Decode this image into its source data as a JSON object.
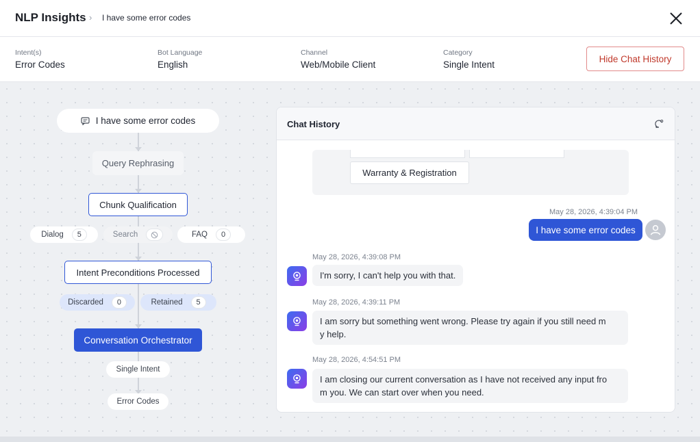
{
  "header": {
    "app_title": "NLP Insights",
    "breadcrumb_sep": "›",
    "breadcrumb": "I have some error codes"
  },
  "meta": {
    "intents_label": "Intent(s)",
    "intents_value": "Error Codes",
    "language_label": "Bot Language",
    "language_value": "English",
    "channel_label": "Channel",
    "channel_value": "Web/Mobile Client",
    "category_label": "Category",
    "category_value": "Single Intent",
    "hide_button": "Hide Chat History"
  },
  "flow": {
    "query": "I have some error codes",
    "rephrasing": "Query Rephrasing",
    "chunk_qualification": "Chunk Qualification",
    "pills_chunk": [
      {
        "label": "Dialog",
        "count": "5"
      },
      {
        "label": "Search",
        "count": ""
      },
      {
        "label": "FAQ",
        "count": "0"
      }
    ],
    "intent_preconditions": "Intent Preconditions Processed",
    "pills_intent": [
      {
        "label": "Discarded",
        "count": "0"
      },
      {
        "label": "Retained",
        "count": "5"
      }
    ],
    "orchestrator": "Conversation Orchestrator",
    "category": "Single Intent",
    "intent": "Error Codes"
  },
  "chat": {
    "title": "Chat History",
    "faq_option": "Warranty & Registration",
    "messages": [
      {
        "sender": "user",
        "time": "May 28, 2026, 4:39:04 PM",
        "text": "I have some error codes"
      },
      {
        "sender": "bot",
        "time": "May 28, 2026, 4:39:08 PM",
        "text": "I'm sorry, I can't help you with that."
      },
      {
        "sender": "bot",
        "time": "May 28, 2026, 4:39:11 PM",
        "text_lines": [
          "I am sorry but something went wrong. Please try again if you still need m",
          "y help."
        ]
      },
      {
        "sender": "bot",
        "time": "May 28, 2026, 4:54:51 PM",
        "text_lines": [
          "I am closing our current conversation as I have not received any input fro",
          "m you. We can start over when you need."
        ]
      }
    ]
  },
  "colors": {
    "accent": "#2f56d6",
    "danger": "#c0392b",
    "bot_gradient_start": "#3d6cf0",
    "bot_gradient_end": "#8b3ee6"
  },
  "icons": {
    "close": "close-icon",
    "query": "message-icon",
    "search_disabled": "ban-icon",
    "chat_header": "chat-refresh-icon",
    "user_avatar": "user-icon",
    "bot_avatar": "bot-icon"
  }
}
